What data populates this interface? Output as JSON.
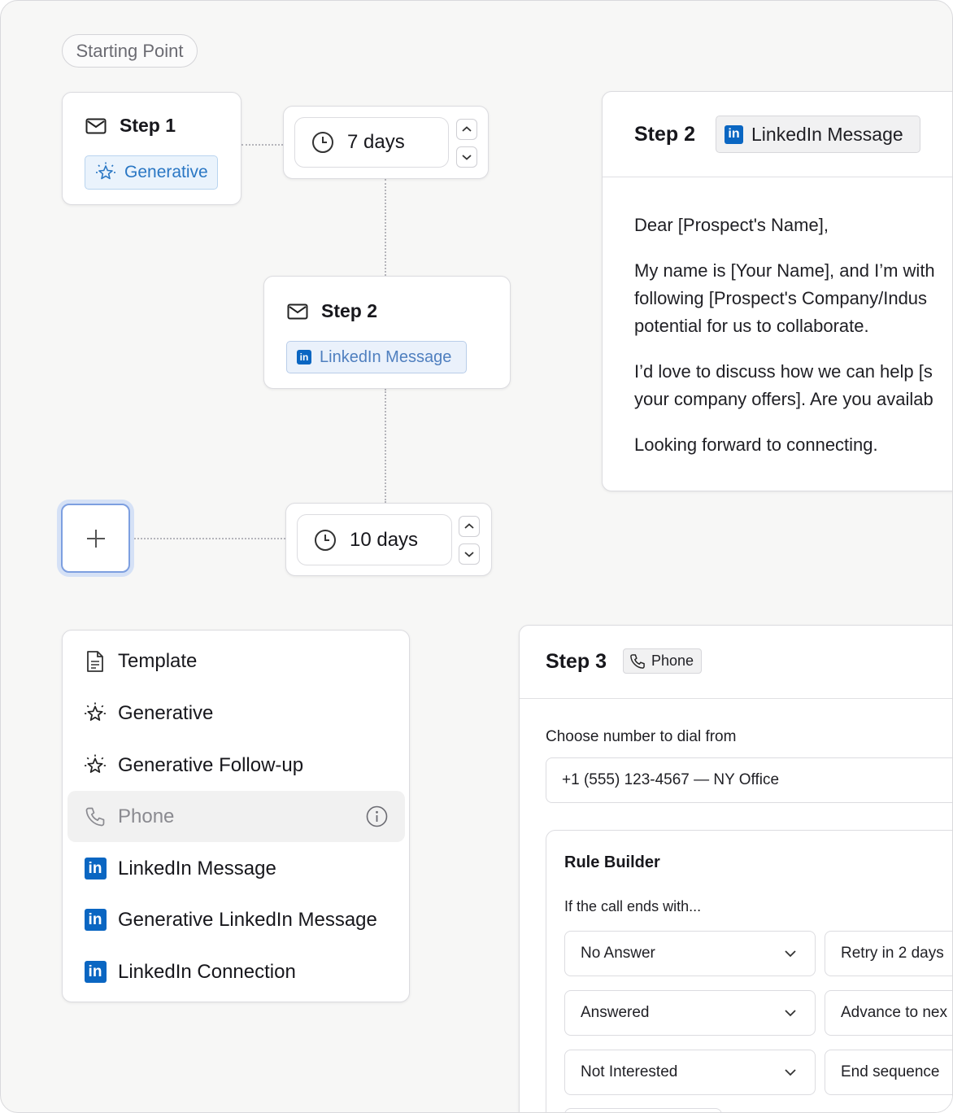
{
  "starting_point": "Starting Point",
  "step1": {
    "title": "Step 1",
    "tag": "Generative"
  },
  "delay1": {
    "label": "7 days"
  },
  "step2": {
    "title": "Step 2",
    "tag": "LinkedIn Message"
  },
  "delay2": {
    "label": "10 days"
  },
  "linkedin_icon_text": "in",
  "menu": {
    "items": [
      {
        "label": "Template",
        "icon": "document-icon"
      },
      {
        "label": "Generative",
        "icon": "sparkle-icon"
      },
      {
        "label": "Generative Follow-up",
        "icon": "sparkle-icon"
      },
      {
        "label": "Phone",
        "icon": "phone-icon",
        "state": "hover"
      },
      {
        "label": "LinkedIn Message",
        "icon": "linkedin-icon"
      },
      {
        "label": "Generative LinkedIn Message",
        "icon": "linkedin-icon"
      },
      {
        "label": "LinkedIn Connection",
        "icon": "linkedin-icon"
      }
    ]
  },
  "step2_panel": {
    "title": "Step 2",
    "tag": "LinkedIn Message",
    "greeting": "Dear [Prospect's Name],",
    "para1_line1": "My name is [Your Name], and I’m with",
    "para1_line2": "following [Prospect's Company/Indus",
    "para1_line3": "potential for us to collaborate.",
    "para2_line1": "I’d love to discuss how we can help [s",
    "para2_line2": "your company offers]. Are you availab",
    "closing": "Looking forward to connecting."
  },
  "step3_panel": {
    "title": "Step 3",
    "tag": "Phone",
    "dial_label": "Choose number to dial from",
    "dial_value": "+1 (555) 123-4567 — NY Office",
    "rule_builder": {
      "title": "Rule Builder",
      "subtitle": "If the call ends with...",
      "rules": [
        {
          "condition": "No Answer",
          "action": "Retry in 2 days"
        },
        {
          "condition": "Answered",
          "action": "Advance to nex"
        },
        {
          "condition": "Not Interested",
          "action": "End sequence"
        }
      ]
    }
  },
  "colors": {
    "linkedin": "#0a66c2",
    "generative_blue": "#2a77c4",
    "focus_ring": "#7d9fe0"
  }
}
